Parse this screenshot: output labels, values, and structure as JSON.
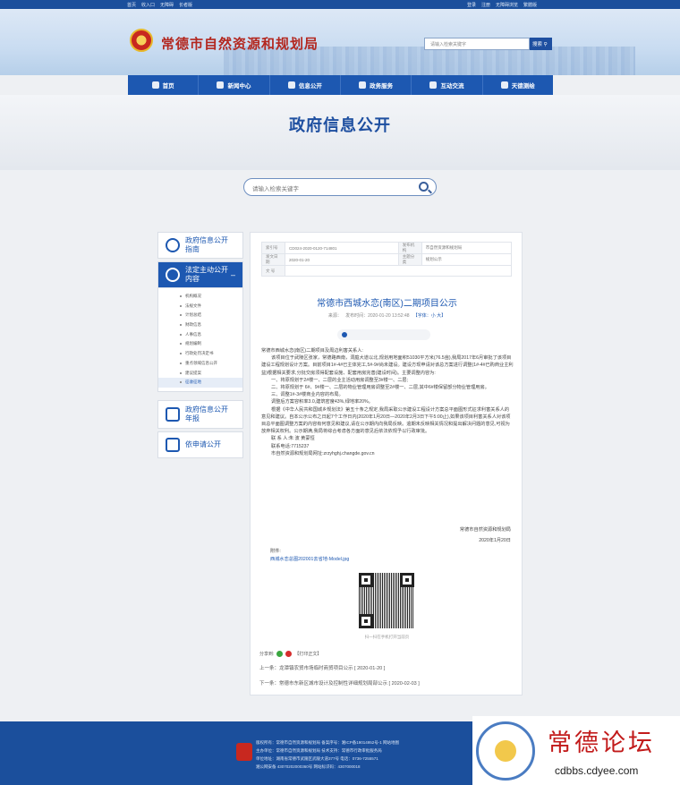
{
  "topbar": {
    "left_links": [
      "首页",
      "收入口",
      "无障碍",
      "长者版"
    ],
    "right_links": [
      "登录",
      "注册",
      "无障碍浏览",
      "繁體版"
    ]
  },
  "header": {
    "site_title": "常德市自然资源和规划局",
    "search_placeholder": "请输入检索关键字",
    "search_button": "搜索"
  },
  "nav": {
    "items": [
      "首页",
      "新闻中心",
      "信息公开",
      "政务服务",
      "互动交流",
      "天德测绘"
    ]
  },
  "page": {
    "heading": "政府信息公开",
    "search_placeholder": "请输入检索关键字"
  },
  "sidebar": {
    "guide": "政府信息公开指南",
    "statutory": "法定主动公开内容",
    "collapse_symbol": "–",
    "sub_items": [
      "机构概况",
      "法规文件",
      "计划总结",
      "财政信息",
      "人事信息",
      "规划编制",
      "行政处罚决定书",
      "重点领域信息公开",
      "建议提案",
      "征收征地"
    ],
    "annual": "政府信息公开年报",
    "apply": "依申请公开"
  },
  "meta": {
    "index_label": "索引号",
    "index_value": "CD024-2020-0120-714801",
    "issuer_label": "发布机构",
    "issuer_value": "市自然资源和规划局",
    "date_label": "发文日期",
    "date_value": "2020-01-20",
    "topic_label": "主题分类",
    "topic_value": "规划公示",
    "doc_label": "文 号",
    "doc_value": ""
  },
  "article": {
    "title": "常德市西城水恋(南区)二期项目公示",
    "source_label": "来源：",
    "publish_label": "发布时间：",
    "publish_value": "2020-01-20 13:52:48",
    "font_label": "【字体：小 大】",
    "paragraphs": [
      "常德市西城水恋(南区)二期项目及周边利害关系人:",
      "该项目位于武陵区张家，常德路西南，洞庭大道以北,规划用地面积51030平方米(76.5亩),我局2017年6月审批了该项目建设工程规划设计方案。目前项目1#-4#已主体完工,5#-9#尚未建设。建设方现申请对该总方案进行调整(1#-4#已购商业主利益)根据相关要求,分批交房须得配套设施、配套用房完善(建设时间)。主要调整内容为:",
      "一、将原规划于2#楼一、二层的业主活动用房调整至3#楼一、二层;",
      "二、将原规划于 6#、9#楼一、二层的物业管理用房调整至2#楼一、二层,其中6#楼保留部分物业管理用房。",
      "三、调整1#-3#楼商业内容的布局。",
      "调整后方案容积率3.0,建筑密度43%,绿地率20%。",
      "根据《中华人民共和国城乡规划法》第五十条之规定,我局采取公示建设工程设计方案总平面图形式征求利害关系人的意见和建议。自本公示公布之日起7个工作日内(2020年1月20日—2020年2月3日下午5:00止),如果该项目利害关系人对该项目总平面图调整方案的内容有何意见和建议,请在公示期内向我局反映。逾期未反映相关情况和提出解决问题的意见,可视为放弃相关权利。公示期满,我局将综合考虑各方面的意见后依法依规予以行政审批。",
      "联 系 人:朱  波    黄蒙恒",
      "联系电话:7715237",
      "市自然资源和规划局网址:zrzyhghj.changde.gov.cn"
    ],
    "sign_org": "常德市自然资源和规划局",
    "sign_date": "2020年1月20日",
    "attach_label": "附件:",
    "attach_link": "西城水恋总图202001去省地-Model.jpg",
    "qr_caption": "扫一扫在手机打开当前页",
    "share_label": "分享到:",
    "print_label": "【打印正文】",
    "prev": "上一条：龙潭镇农贸市场临时商贸项目公示 [ 2020-01-20 ]",
    "next": "下一条：常德市东新区城市设计及控制性详细规划局部公示 [ 2020-02-03 ]"
  },
  "footer": {
    "rows": [
      "版权所有：常德市自然资源和规划局        备案序号：湘ICP备19014952号-1        网站地图",
      "主办单位：常德市自然资源和规划局        技术支持：常德市行政审批服务局",
      "单位地址：湖南省常德市武陵区武陵大道377号        电话：0736-7255571",
      "湘公网安备 43070202000360号        网站标识码：4307000018"
    ]
  },
  "watermark": {
    "big": "常德论坛",
    "url": "cdbbs.cdyee.com"
  },
  "colors": {
    "brand_blue": "#1d58b1",
    "title_red": "#b3271f",
    "footer_blue": "#1b4f9c"
  }
}
